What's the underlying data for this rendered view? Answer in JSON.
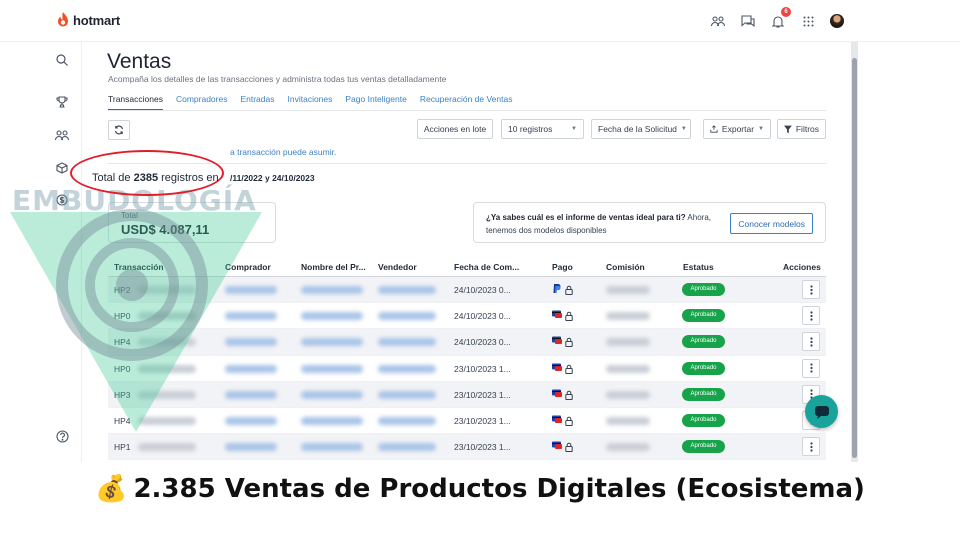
{
  "app": {
    "logo_text": "hotmart",
    "notification_count": "6"
  },
  "page": {
    "title": "Ventas",
    "subtitle": "Acompaña los detalles de las transacciones y administra todas tus ventas detalladamente"
  },
  "tabs": [
    {
      "label": "Transacciones",
      "active": true
    },
    {
      "label": "Compradores"
    },
    {
      "label": "Entradas"
    },
    {
      "label": "Invitaciones"
    },
    {
      "label": "Pago Inteligente"
    },
    {
      "label": "Recuperación de Ventas"
    }
  ],
  "toolbar": {
    "batch_label": "Acciones en lote",
    "per_page_label": "10 registros",
    "date_filter_label": "Fecha de la Solicitud",
    "export_label": "Exportar",
    "filters_label": "Filtros"
  },
  "info_link": "a transacción puede asumir.",
  "summary": {
    "total_prefix": "Total de ",
    "total_count": "2385",
    "total_suffix": " registros en",
    "date_range": "/11/2022 y 24/10/2023"
  },
  "total_card": {
    "label": "Total",
    "value": "USD$ 4.087,11"
  },
  "promo": {
    "question": "¿Ya sabes cuál es el informe de ventas ideal para ti?",
    "text": " Ahora, tenemos dos modelos disponibles",
    "button": "Conocer modelos"
  },
  "table": {
    "headers": {
      "transaction": "Transacción",
      "buyer": "Comprador",
      "product": "Nombre del Pr...",
      "seller": "Vendedor",
      "date": "Fecha de Com...",
      "payment": "Pago",
      "commission": "Comisión",
      "status": "Estatus",
      "actions": "Acciones"
    },
    "rows": [
      {
        "transaction": "HP2",
        "date": "24/10/2023 0...",
        "status": "Aprobado",
        "payment_icon": "paypal-icon"
      },
      {
        "transaction": "HP0",
        "date": "24/10/2023 0...",
        "status": "Aprobado",
        "payment_icon": "card-icon"
      },
      {
        "transaction": "HP4",
        "date": "24/10/2023 0...",
        "status": "Aprobado",
        "payment_icon": "card-icon"
      },
      {
        "transaction": "HP0",
        "date": "23/10/2023 1...",
        "status": "Aprobado",
        "payment_icon": "card-icon"
      },
      {
        "transaction": "HP3",
        "date": "23/10/2023 1...",
        "status": "Aprobado",
        "payment_icon": "card-icon"
      },
      {
        "transaction": "HP4",
        "date": "23/10/2023 1...",
        "status": "Aprobado",
        "payment_icon": "card-icon"
      },
      {
        "transaction": "HP1",
        "date": "23/10/2023 1...",
        "status": "Aprobado",
        "payment_icon": "card-icon"
      }
    ]
  },
  "watermark": {
    "text": "EMBUDOLOGÍA"
  },
  "caption": {
    "emoji": "💰",
    "text": "2.385 Ventas de Productos Digitales (Ecosistema)"
  },
  "colors": {
    "accent": "#2b6cb0",
    "status_green": "#16a34a",
    "highlight_red": "#e11d2a",
    "chat_teal": "#1aa39a"
  }
}
